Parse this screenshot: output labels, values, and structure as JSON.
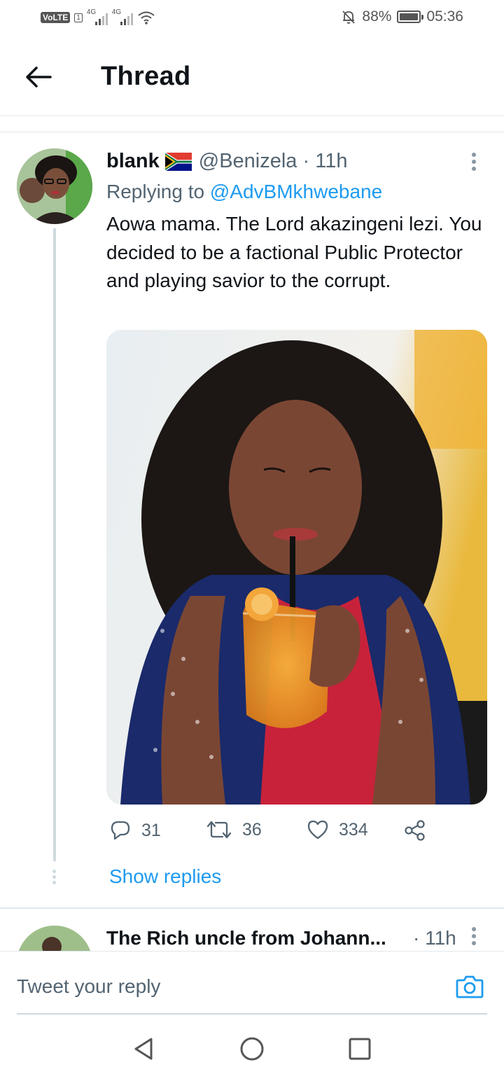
{
  "status_bar": {
    "volte": "VoLTE",
    "sim": "1",
    "network_1": "4G",
    "network_2": "4G",
    "battery": "88%",
    "time": "05:36"
  },
  "header": {
    "title": "Thread"
  },
  "tweet": {
    "name": "blank",
    "handle": "@Benizela",
    "separator": " · ",
    "time": "11h",
    "replying_prefix": "Replying to ",
    "replying_to": "@AdvBMkhwebane",
    "text": "Aowa mama. The Lord akazingeni lezi. You decided to be a factional Public Protector and playing savior to the corrupt.",
    "replies": "31",
    "retweets": "36",
    "likes": "334",
    "show_replies": "Show replies"
  },
  "next_tweet": {
    "name": "The Rich uncle from Johann...",
    "time": "· 11h"
  },
  "reply_bar": {
    "placeholder": "Tweet your reply"
  },
  "colors": {
    "accent": "#1d9bf0",
    "secondary_text": "#536471",
    "line": "#cfd9de"
  }
}
